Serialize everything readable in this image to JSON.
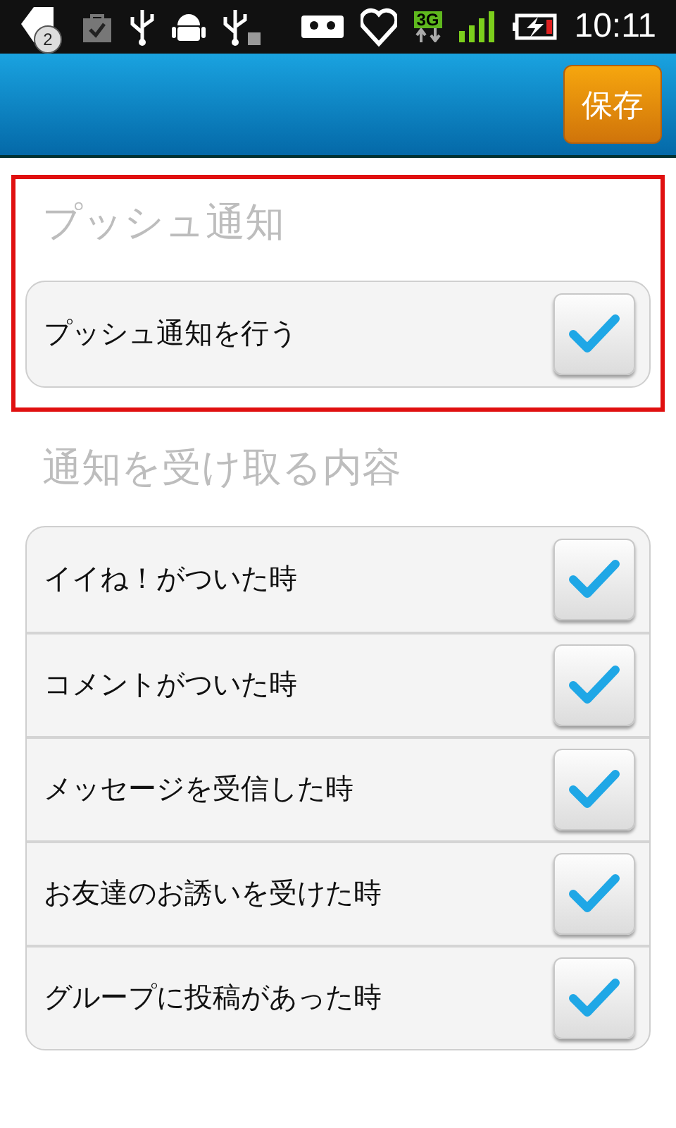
{
  "status_bar": {
    "notification_count": "2",
    "network": "3G",
    "time": "10:11"
  },
  "header": {
    "save_button": "保存"
  },
  "sections": [
    {
      "title": "プッシュ通知",
      "highlighted": true,
      "items": [
        {
          "label": "プッシュ通知を行う",
          "checked": true
        }
      ]
    },
    {
      "title": "通知を受け取る内容",
      "items": [
        {
          "label": "イイね！がついた時",
          "checked": true
        },
        {
          "label": "コメントがついた時",
          "checked": true
        },
        {
          "label": "メッセージを受信した時",
          "checked": true
        },
        {
          "label": "お友達のお誘いを受けた時",
          "checked": true
        },
        {
          "label": "グループに投稿があった時",
          "checked": true
        }
      ]
    }
  ]
}
